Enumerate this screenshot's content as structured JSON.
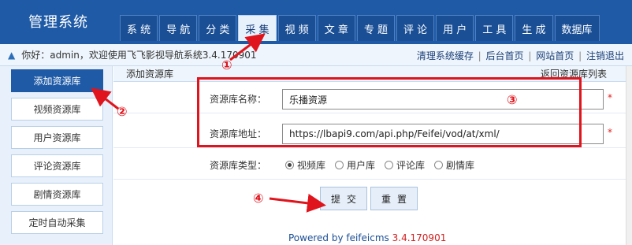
{
  "header": {
    "brand": "管理系统",
    "tabs": [
      "系 统",
      "导 航",
      "分 类",
      "采 集",
      "视 频",
      "文 章",
      "专 题",
      "评 论",
      "用 户",
      "工 具",
      "生 成",
      "数据库"
    ],
    "active_tab": "采 集"
  },
  "infobar": {
    "welcome": "你好：admin，欢迎使用飞飞影视导航系统3.4.170901",
    "links": [
      "清理系统缓存",
      "后台首页",
      "网站首页",
      "注销退出"
    ],
    "separator": "|",
    "icon": "user-icon"
  },
  "sidebar": {
    "items": [
      "添加资源库",
      "视频资源库",
      "用户资源库",
      "评论资源库",
      "剧情资源库",
      "定时自动采集"
    ]
  },
  "main": {
    "title": "添加资源库",
    "list_link": "返回资源库列表",
    "name_label": "资源库名称：",
    "name_value": "乐播资源",
    "url_label": "资源库地址：",
    "url_value": "https://lbapi9.com/api.php/Feifei/vod/at/xml/",
    "required_mark": "*",
    "type_label": "资源库类型：",
    "types": [
      "视频库",
      "用户库",
      "评论库",
      "剧情库"
    ],
    "selected_type": "视频库",
    "submit": "提交",
    "reset": "重置",
    "powered_by": "Powered by feifeicms",
    "powered_version": "3.4.170901"
  },
  "annotations": {
    "marks": [
      "①",
      "②",
      "③",
      "④"
    ],
    "color": "#e0141c"
  },
  "colors": {
    "header_bg": "#1f5aa6",
    "accent": "#e0141c"
  }
}
